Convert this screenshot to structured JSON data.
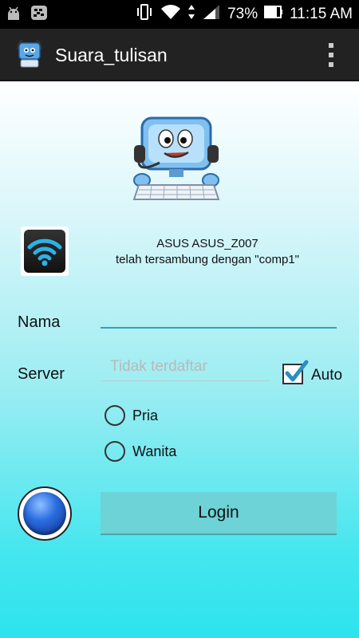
{
  "status_bar": {
    "battery_percent": "73%",
    "time": "11:15 AM",
    "icons": [
      "android-debug-icon",
      "blackberry-messenger-icon",
      "vibrate-icon",
      "wifi-icon",
      "data-transfer-icon",
      "signal-icon",
      "battery-icon"
    ]
  },
  "action_bar": {
    "title": "Suara_tulisan",
    "overflow_icon": "overflow-menu-icon"
  },
  "connection": {
    "device": "ASUS ASUS_Z007",
    "status": "telah tersambung dengan \"comp1\""
  },
  "form": {
    "nama_label": "Nama",
    "nama_value": "",
    "server_label": "Server",
    "server_placeholder": "Tidak terdaftar",
    "auto_label": "Auto",
    "auto_checked": true,
    "gender_options": [
      "Pria",
      "Wanita"
    ],
    "login_label": "Login"
  },
  "colors": {
    "action_bar": "#222222",
    "gradient_bottom": "#2de3ee",
    "login_button": "#6dd3d6",
    "input_underline": "#2ea3bd"
  }
}
